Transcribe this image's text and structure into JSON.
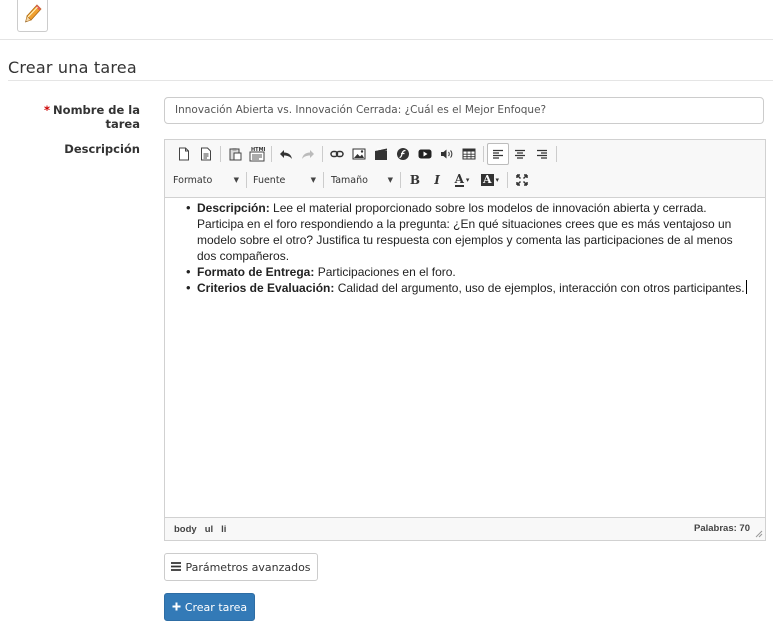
{
  "page": {
    "section_title": "Crear una tarea"
  },
  "form": {
    "name_label": "Nombre de la tarea",
    "required_mark": "*",
    "name_value": "Innovación Abierta vs. Innovación Cerrada: ¿Cuál es el Mejor Enfoque?",
    "description_label": "Descripción"
  },
  "editor": {
    "toolbar": {
      "format_label": "Formato",
      "font_label": "Fuente",
      "size_label": "Tamaño",
      "bold_label": "B",
      "italic_label": "I",
      "text_color_label": "A",
      "bg_color_label": "A"
    },
    "content": {
      "items": [
        {
          "heading": "Descripción:",
          "text": " Lee el material proporcionado sobre los modelos de innovación abierta y cerrada. Participa en el foro respondiendo a la pregunta: ¿En qué situaciones crees que es más ventajoso un modelo sobre el otro? Justifica tu respuesta con ejemplos y comenta las participaciones de al menos dos compañeros."
        },
        {
          "heading": "Formato de Entrega:",
          "text": " Participaciones en el foro."
        },
        {
          "heading": "Criterios de Evaluación:",
          "text": " Calidad del argumento, uso de ejemplos, interacción con otros participantes."
        }
      ]
    },
    "status": {
      "path": [
        "body",
        "ul",
        "li"
      ],
      "word_count": "Palabras: 70"
    }
  },
  "actions": {
    "advanced_label": "Parámetros avanzados",
    "create_label": "Crear tarea"
  },
  "colors": {
    "primary": "#337ab7",
    "required": "#cc0000"
  }
}
